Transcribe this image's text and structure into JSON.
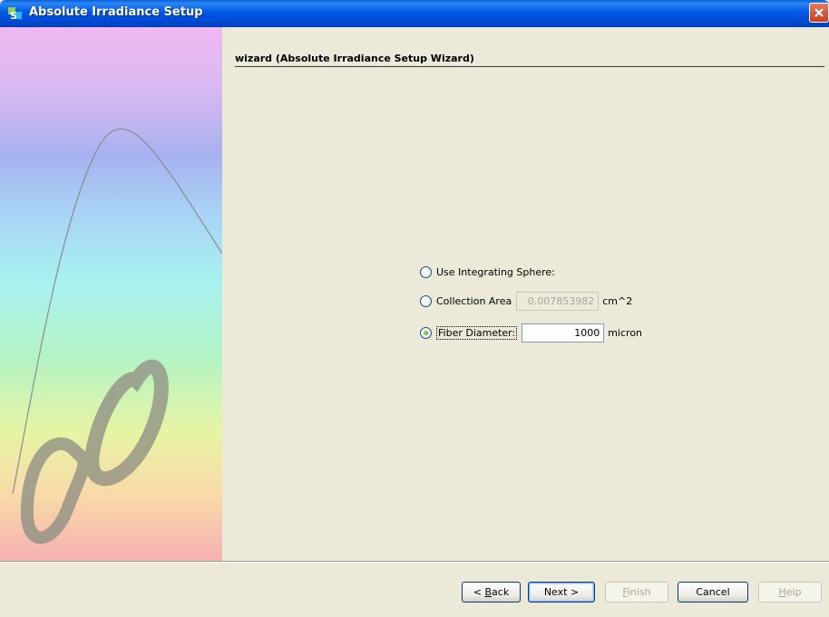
{
  "window": {
    "title": "Absolute Irradiance Setup",
    "icon": "spectrasuite-app-icon",
    "titlebar_color": "#0054e3"
  },
  "header": {
    "wizard_title": "wizard (Absolute Irradiance Setup Wizard)"
  },
  "options": {
    "integrating_sphere": {
      "label": "Use Integrating Sphere:",
      "selected": false
    },
    "collection_area": {
      "label": "Collection Area",
      "value": "0.007853982",
      "unit": "cm^2",
      "enabled": false,
      "selected": false
    },
    "fiber_diameter": {
      "label": "Fiber Diameter:",
      "value": "1000",
      "unit": "micron",
      "enabled": true,
      "selected": true
    }
  },
  "buttons": {
    "back": {
      "prefix": "< ",
      "mnemonic": "B",
      "rest": "ack",
      "enabled": true
    },
    "next": {
      "label": "Next >",
      "enabled": true,
      "default": true
    },
    "finish": {
      "mnemonic": "F",
      "rest": "inish",
      "enabled": false
    },
    "cancel": {
      "label": "Cancel",
      "enabled": true
    },
    "help": {
      "mnemonic": "H",
      "rest": "elp",
      "enabled": false
    }
  }
}
